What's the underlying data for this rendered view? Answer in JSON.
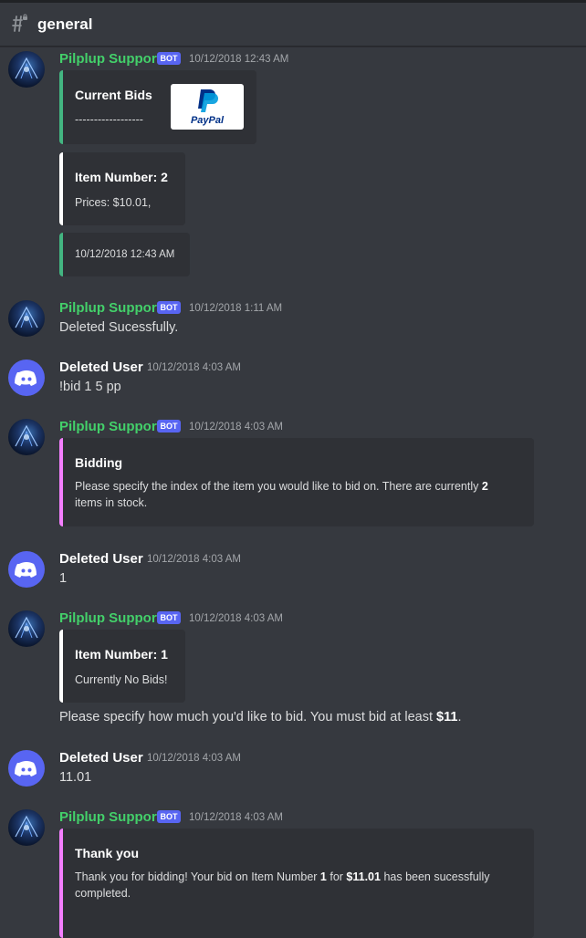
{
  "channel": {
    "name": "general"
  },
  "bot_badge": "BOT",
  "messages": [
    {
      "author": "Pilplup Support",
      "time": "10/12/2018 12:43 AM",
      "embeds": [
        {
          "title": "Current Bids",
          "desc": "------------------",
          "thumbnail": "PayPal"
        },
        {
          "title": "Item Number: 2",
          "desc": "Prices: $10.01,"
        },
        {
          "desc": "10/12/2018 12:43 AM"
        }
      ]
    },
    {
      "author": "Pilplup Support",
      "time": "10/12/2018 1:11 AM",
      "text": "Deleted Sucessfully."
    },
    {
      "author": "Deleted User",
      "time": "10/12/2018 4:03 AM",
      "text": "!bid 1 5 pp"
    },
    {
      "author": "Pilplup Support",
      "time": "10/12/2018 4:03 AM",
      "embed": {
        "title": "Bidding",
        "desc_line1_pre": "Please specify the index of the item you would like to bid on. There are currently ",
        "desc_line1_bold": "2",
        "desc_line2": "items in stock."
      }
    },
    {
      "author": "Deleted User",
      "time": "10/12/2018 4:03 AM",
      "text": "1"
    },
    {
      "author": "Pilplup Support",
      "time": "10/12/2018 4:03 AM",
      "embed": {
        "title": "Item Number: 1",
        "desc": "Currently No Bids!"
      },
      "text_pre": "Please specify how much you'd like to bid. You must bid at least ",
      "text_bold": "$11",
      "text_post": "."
    },
    {
      "author": "Deleted User",
      "time": "10/12/2018 4:03 AM",
      "text": "11.01"
    },
    {
      "author": "Pilplup Support",
      "time": "10/12/2018 4:03 AM",
      "embed": {
        "title": "Thank you",
        "desc_a": "Thank you for bidding! Your bid on Item Number ",
        "desc_b": "1",
        "desc_c": " for ",
        "desc_d": "$11.01",
        "desc_e": " has been sucessfully",
        "desc_line2": "completed."
      }
    }
  ],
  "colors": {
    "background": "#36393f",
    "embed_bg": "#2f3136",
    "bot_name": "#43d06a",
    "blurple": "#5865f2",
    "green_bar": "#43b581",
    "pink_bar": "#f47fff"
  }
}
